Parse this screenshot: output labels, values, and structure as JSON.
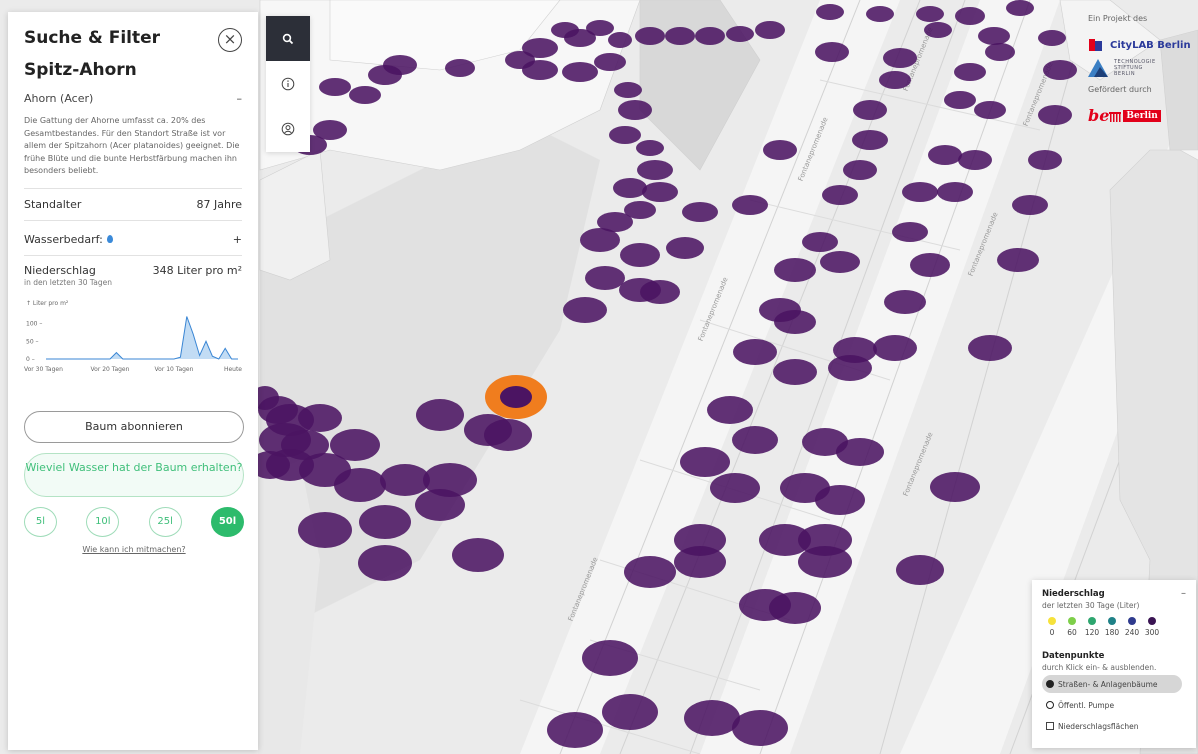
{
  "panel": {
    "title": "Suche & Filter",
    "close_icon": "×",
    "tree_name": "Spitz-Ahorn",
    "genus": "Ahorn (Acer)",
    "genus_toggle": "–",
    "genus_description": "Die Gattung der Ahorne umfasst ca. 20% des Gesamtbestandes. Für den Standort Straße ist vor allem der Spitzahorn (Acer platanoides) geeignet. Die frühe Blüte und die bunte Herbstfärbung machen ihn besonders beliebt.",
    "age_label": "Standalter",
    "age_value": "87 Jahre",
    "water_label": "Wasserbedarf:",
    "water_toggle": "+",
    "rain_label": "Niederschlag",
    "rain_value": "348 Liter pro m²",
    "rain_sub": "in den letzten 30 Tagen",
    "subscribe_button": "Baum abonnieren",
    "water_question_button": "Wieviel Wasser hat der Baum erhalten?",
    "amounts": [
      "5l",
      "10l",
      "25l",
      "50l"
    ],
    "amount_selected": "50l",
    "help_link": "Wie kann ich mitmachen?"
  },
  "rain_chart": {
    "y_unit_label": "↑ Liter pro m²",
    "y_ticks": [
      "100 –",
      "50 –",
      "0 –"
    ],
    "x_ticks": [
      "Vor 30 Tagen",
      "Vor 20 Tagen",
      "Vor 10 Tagen",
      "Heute"
    ]
  },
  "chart_data": {
    "type": "area",
    "title": "",
    "xlabel": "",
    "ylabel": "Liter pro m²",
    "ylim": [
      0,
      130
    ],
    "x": [
      30,
      29,
      28,
      27,
      26,
      25,
      24,
      23,
      22,
      21,
      20,
      19,
      18,
      17,
      16,
      15,
      14,
      13,
      12,
      11,
      10,
      9,
      8,
      7,
      6,
      5,
      4,
      3,
      2,
      1,
      0
    ],
    "series": [
      {
        "values": [
          0,
          0,
          0,
          0,
          0,
          0,
          0,
          0,
          0,
          0,
          0,
          18,
          0,
          0,
          0,
          0,
          0,
          0,
          0,
          0,
          0,
          5,
          120,
          70,
          10,
          50,
          8,
          0,
          30,
          0,
          0
        ]
      }
    ]
  },
  "toolbar": {
    "search_icon": "search-icon",
    "info_icon": "info-icon",
    "account_icon": "account-icon"
  },
  "logos": {
    "project_label": "Ein Projekt des",
    "citylab_text": "CityLAB Berlin",
    "tsb_lines": [
      "TECHNOLOGIE",
      "STIFTUNG",
      "BERLIN"
    ],
    "funded_label": "Gefördert durch",
    "be_text": "be",
    "berlin_text": "Berlin"
  },
  "map": {
    "street_name": "Fontanepromenade",
    "tree_color": "#4b1462",
    "selected_color": "#f07d1e"
  },
  "legend": {
    "title": "Niederschlag",
    "subtitle": "der letzten 30 Tage (Liter)",
    "collapse": "–",
    "scale": [
      {
        "label": "0",
        "color": "#f6e23b"
      },
      {
        "label": "60",
        "color": "#7ecf4a"
      },
      {
        "label": "120",
        "color": "#2ea66f"
      },
      {
        "label": "180",
        "color": "#1f8187"
      },
      {
        "label": "240",
        "color": "#2f3b8e"
      },
      {
        "label": "300",
        "color": "#3a1453"
      }
    ],
    "datapoints_title": "Datenpunkte",
    "datapoints_sub": "durch Klick ein- & ausblenden.",
    "items": [
      "Straßen- & Anlagenbäume",
      "Öffentl. Pumpe",
      "Niederschlagsflächen"
    ]
  }
}
